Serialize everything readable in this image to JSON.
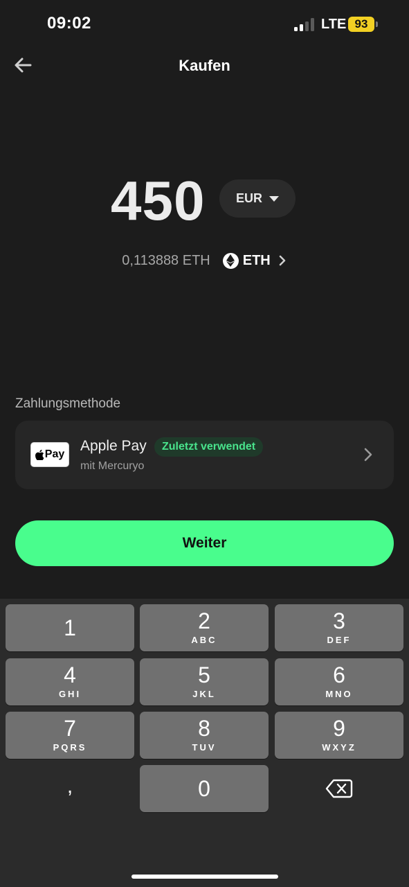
{
  "status_bar": {
    "time": "09:02",
    "network": "LTE",
    "battery": "93",
    "icons": [
      "signal-icon",
      "battery-icon"
    ]
  },
  "header": {
    "title": "Kaufen",
    "back_icon": "arrow-left-icon"
  },
  "amount": {
    "value": "450",
    "currency": "EUR"
  },
  "conversion": {
    "crypto_amount": "0,113888 ETH",
    "asset": "ETH",
    "icon": "ethereum-icon"
  },
  "payment": {
    "section_label": "Zahlungsmethode",
    "method_name": "Apple Pay",
    "logo_text": "Pay",
    "badge": "Zuletzt verwendet",
    "provider": "mit Mercuryo"
  },
  "primary_button": {
    "label": "Weiter"
  },
  "keypad": {
    "keys": [
      {
        "digit": "1",
        "letters": ""
      },
      {
        "digit": "2",
        "letters": "ABC"
      },
      {
        "digit": "3",
        "letters": "DEF"
      },
      {
        "digit": "4",
        "letters": "GHI"
      },
      {
        "digit": "5",
        "letters": "JKL"
      },
      {
        "digit": "6",
        "letters": "MNO"
      },
      {
        "digit": "7",
        "letters": "PQRS"
      },
      {
        "digit": "8",
        "letters": "TUV"
      },
      {
        "digit": "9",
        "letters": "WXYZ"
      },
      {
        "digit": ",",
        "letters": ""
      },
      {
        "digit": "0",
        "letters": ""
      }
    ],
    "delete_icon": "backspace-icon"
  },
  "colors": {
    "background": "#1c1c1c",
    "accent": "#49fd8d",
    "card": "#262626",
    "badge_text": "#49e38c",
    "battery": "#f2d023"
  }
}
